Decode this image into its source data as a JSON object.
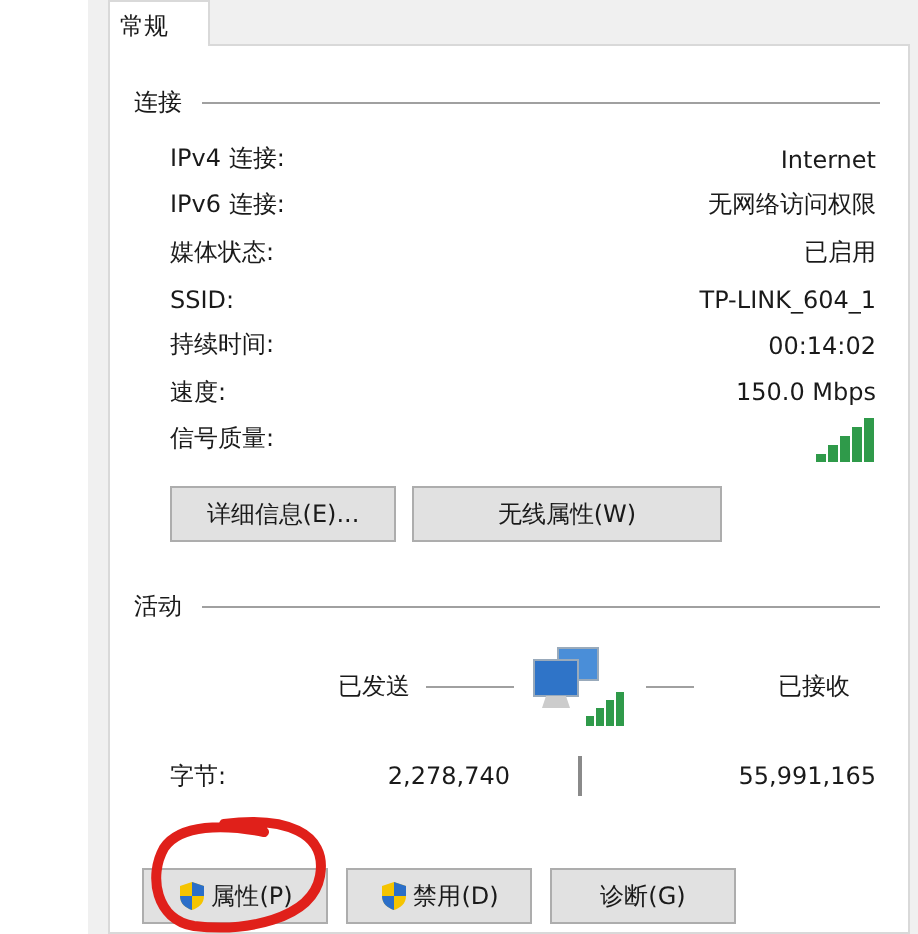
{
  "tabs": [
    {
      "label": "常规",
      "selected": true
    }
  ],
  "connection": {
    "title": "连接",
    "rows": [
      {
        "kind": "text",
        "label": "IPv4 连接:",
        "value": "Internet"
      },
      {
        "kind": "text",
        "label": "IPv6 连接:",
        "value": "无网络访问权限"
      },
      {
        "kind": "text",
        "label": "媒体状态:",
        "value": "已启用"
      },
      {
        "kind": "text",
        "label": "SSID:",
        "value": "TP-LINK_604_1"
      },
      {
        "kind": "text",
        "label": "持续时间:",
        "value": "00:14:02"
      },
      {
        "kind": "text",
        "label": "速度:",
        "value": "150.0 Mbps"
      },
      {
        "kind": "signal",
        "label": "信号质量:"
      }
    ],
    "buttons": [
      "详细信息(E)...",
      "无线属性(W)"
    ]
  },
  "activity": {
    "title": "活动",
    "sent_label": "已发送",
    "received_label": "已接收",
    "bytes_label": "字节:",
    "sent": "2,278,740",
    "received": "55,991,165"
  },
  "footer_buttons": [
    {
      "label": "属性(P)",
      "shield": true
    },
    {
      "label": "禁用(D)",
      "shield": true
    },
    {
      "label": "诊断(G)",
      "shield": false
    }
  ]
}
